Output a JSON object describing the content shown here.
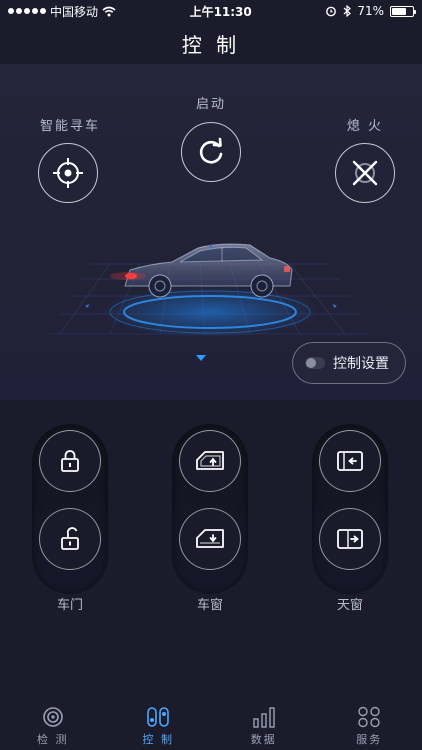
{
  "status_bar": {
    "carrier": "中国移动",
    "time": "上午11:30",
    "battery": "71%",
    "battery_level": 0.71
  },
  "header": {
    "title": "控 制"
  },
  "hero": {
    "find_car_label": "智能寻车",
    "start_label": "启动",
    "stall_label": "熄 火",
    "control_settings_label": "控制设置"
  },
  "controls": {
    "door_label": "车门",
    "window_label": "车窗",
    "sunroof_label": "天窗"
  },
  "tabs": [
    {
      "label": "检 测",
      "icon": "inspection-icon",
      "active": false
    },
    {
      "label": "控 制",
      "icon": "control-icon",
      "active": true
    },
    {
      "label": "数据",
      "icon": "data-icon",
      "active": false
    },
    {
      "label": "服务",
      "icon": "service-icon",
      "active": false
    }
  ],
  "colors": {
    "accent": "#4aa8ff",
    "background": "#1b1b2b"
  }
}
